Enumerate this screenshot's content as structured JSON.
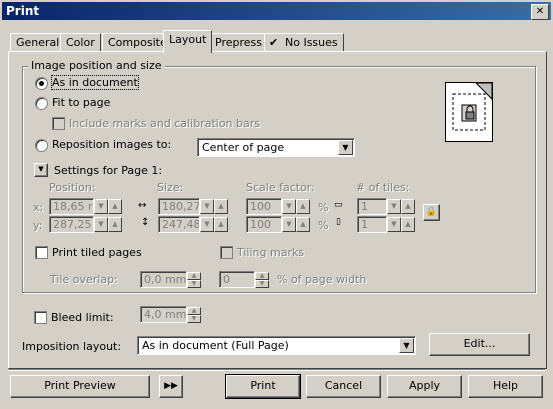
{
  "window": {
    "title": "Print",
    "close_glyph": "✕"
  },
  "tabs": [
    {
      "label": "General"
    },
    {
      "label": "Color"
    },
    {
      "label": "Composite"
    },
    {
      "label": "Layout"
    },
    {
      "label": "Prepress"
    },
    {
      "label": "No Issues"
    }
  ],
  "active_tab": "Layout",
  "image_position": {
    "group_label": "Image position and size",
    "as_in_document": "As in document",
    "fit_to_page": "Fit to page",
    "include_marks": "Include marks and calibration bars",
    "reposition": "Reposition images to:",
    "reposition_value": "Center of page",
    "settings_label": "Settings for Page 1:"
  },
  "settings": {
    "position_label": "Position:",
    "size_label": "Size:",
    "scale_label": "Scale factor:",
    "tiles_label": "# of tiles:",
    "x_label": "x:",
    "y_label": "y:",
    "x_value": "18,65 r",
    "y_value": "287,25",
    "width_value": "180,27",
    "height_value": "247,48",
    "scale_x": "100",
    "scale_y": "100",
    "percent": "%",
    "tiles_x": "1",
    "tiles_y": "1"
  },
  "tiling": {
    "print_tiled_pages": "Print tiled pages",
    "tiling_marks": "Tiling marks",
    "tile_overlap_label": "Tile overlap:",
    "tile_overlap_value": "0,0 mm",
    "page_width_value": "0",
    "page_width_label": "% of page width"
  },
  "bleed": {
    "label": "Bleed limit:",
    "value": "4,0 mm"
  },
  "imposition": {
    "label": "Imposition layout:",
    "value": "As in document (Full Page)",
    "edit_button": "Edit..."
  },
  "footer": {
    "print_preview": "Print Preview",
    "print": "Print",
    "cancel": "Cancel",
    "apply": "Apply",
    "help": "Help"
  }
}
